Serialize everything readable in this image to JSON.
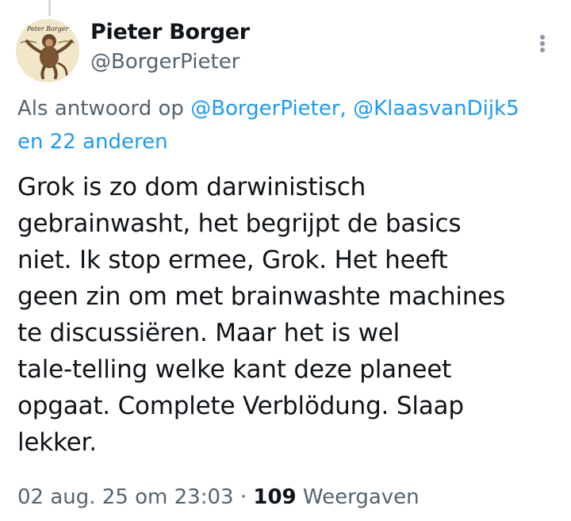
{
  "author": {
    "display_name": "Pieter Borger",
    "handle": "@BorgerPieter",
    "avatar_caption": "Peter Borger"
  },
  "reply_context": {
    "prefix": "Als antwoord op",
    "mention_1": "@BorgerPieter,",
    "mention_2": "@KlaasvanDijk5",
    "others": "en 22 anderen"
  },
  "tweet": {
    "lines": [
      "Grok is zo dom darwinistisch",
      "gebrainwasht, het begrijpt de basics",
      "niet. Ik stop ermee, Grok. Het heeft",
      "geen zin om met brainwashte machines",
      "te discussiëren. Maar het is wel",
      "tale-telling welke kant deze planeet",
      "opgaat. Complete Verblödung. Slaap",
      "lekker."
    ]
  },
  "meta": {
    "timestamp": "02 aug. 25 om 23:03",
    "separator": "·",
    "views_count": "109",
    "views_label": "Weergaven"
  },
  "colors": {
    "text": "#0f1419",
    "secondary": "#536471",
    "link": "#1d9bf0"
  },
  "icons": {
    "more": "vertical-ellipsis-icon"
  }
}
